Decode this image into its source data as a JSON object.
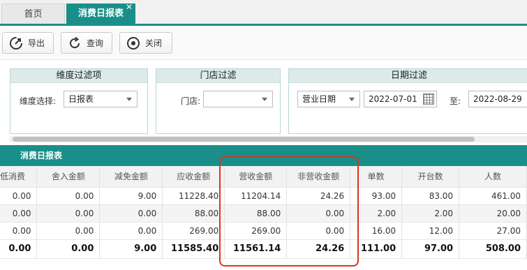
{
  "tabs": [
    {
      "label": "首页",
      "active": false
    },
    {
      "label": "消费日报表",
      "active": true,
      "close": "✕"
    }
  ],
  "toolbar": {
    "export_label": "导出",
    "query_label": "查询",
    "close_label": "关闭"
  },
  "filters": {
    "dimension": {
      "title": "维度过滤项",
      "label": "维度选择:",
      "value": "日报表"
    },
    "store": {
      "title": "门店过滤",
      "label": "门店:",
      "value": ""
    },
    "date": {
      "title": "日期过滤",
      "type_value": "营业日期",
      "start": "2022-07-01",
      "to_label": "至:",
      "end": "2022-08-29"
    }
  },
  "report": {
    "title": "消费日报表",
    "columns": [
      "低消费",
      "舍入金额",
      "减免金额",
      "应收金额",
      "营收金额",
      "非营收金额",
      "单数",
      "开台数",
      "人数"
    ],
    "rows": [
      [
        "0.00",
        "0.00",
        "9.00",
        "11228.40",
        "11204.14",
        "24.26",
        "93.00",
        "83.00",
        "461.00"
      ],
      [
        "0.00",
        "0.00",
        "0.00",
        "88.00",
        "88.00",
        "0.00",
        "2.00",
        "2.00",
        "20.00"
      ],
      [
        "0.00",
        "0.00",
        "0.00",
        "269.00",
        "269.00",
        "0.00",
        "16.00",
        "12.00",
        "27.00"
      ]
    ],
    "totals": [
      "0.00",
      "0.00",
      "9.00",
      "11585.40",
      "11561.14",
      "24.26",
      "111.00",
      "97.00",
      "508.00"
    ]
  },
  "colors": {
    "accent": "#1a8f8a",
    "highlight": "#e0321f"
  }
}
